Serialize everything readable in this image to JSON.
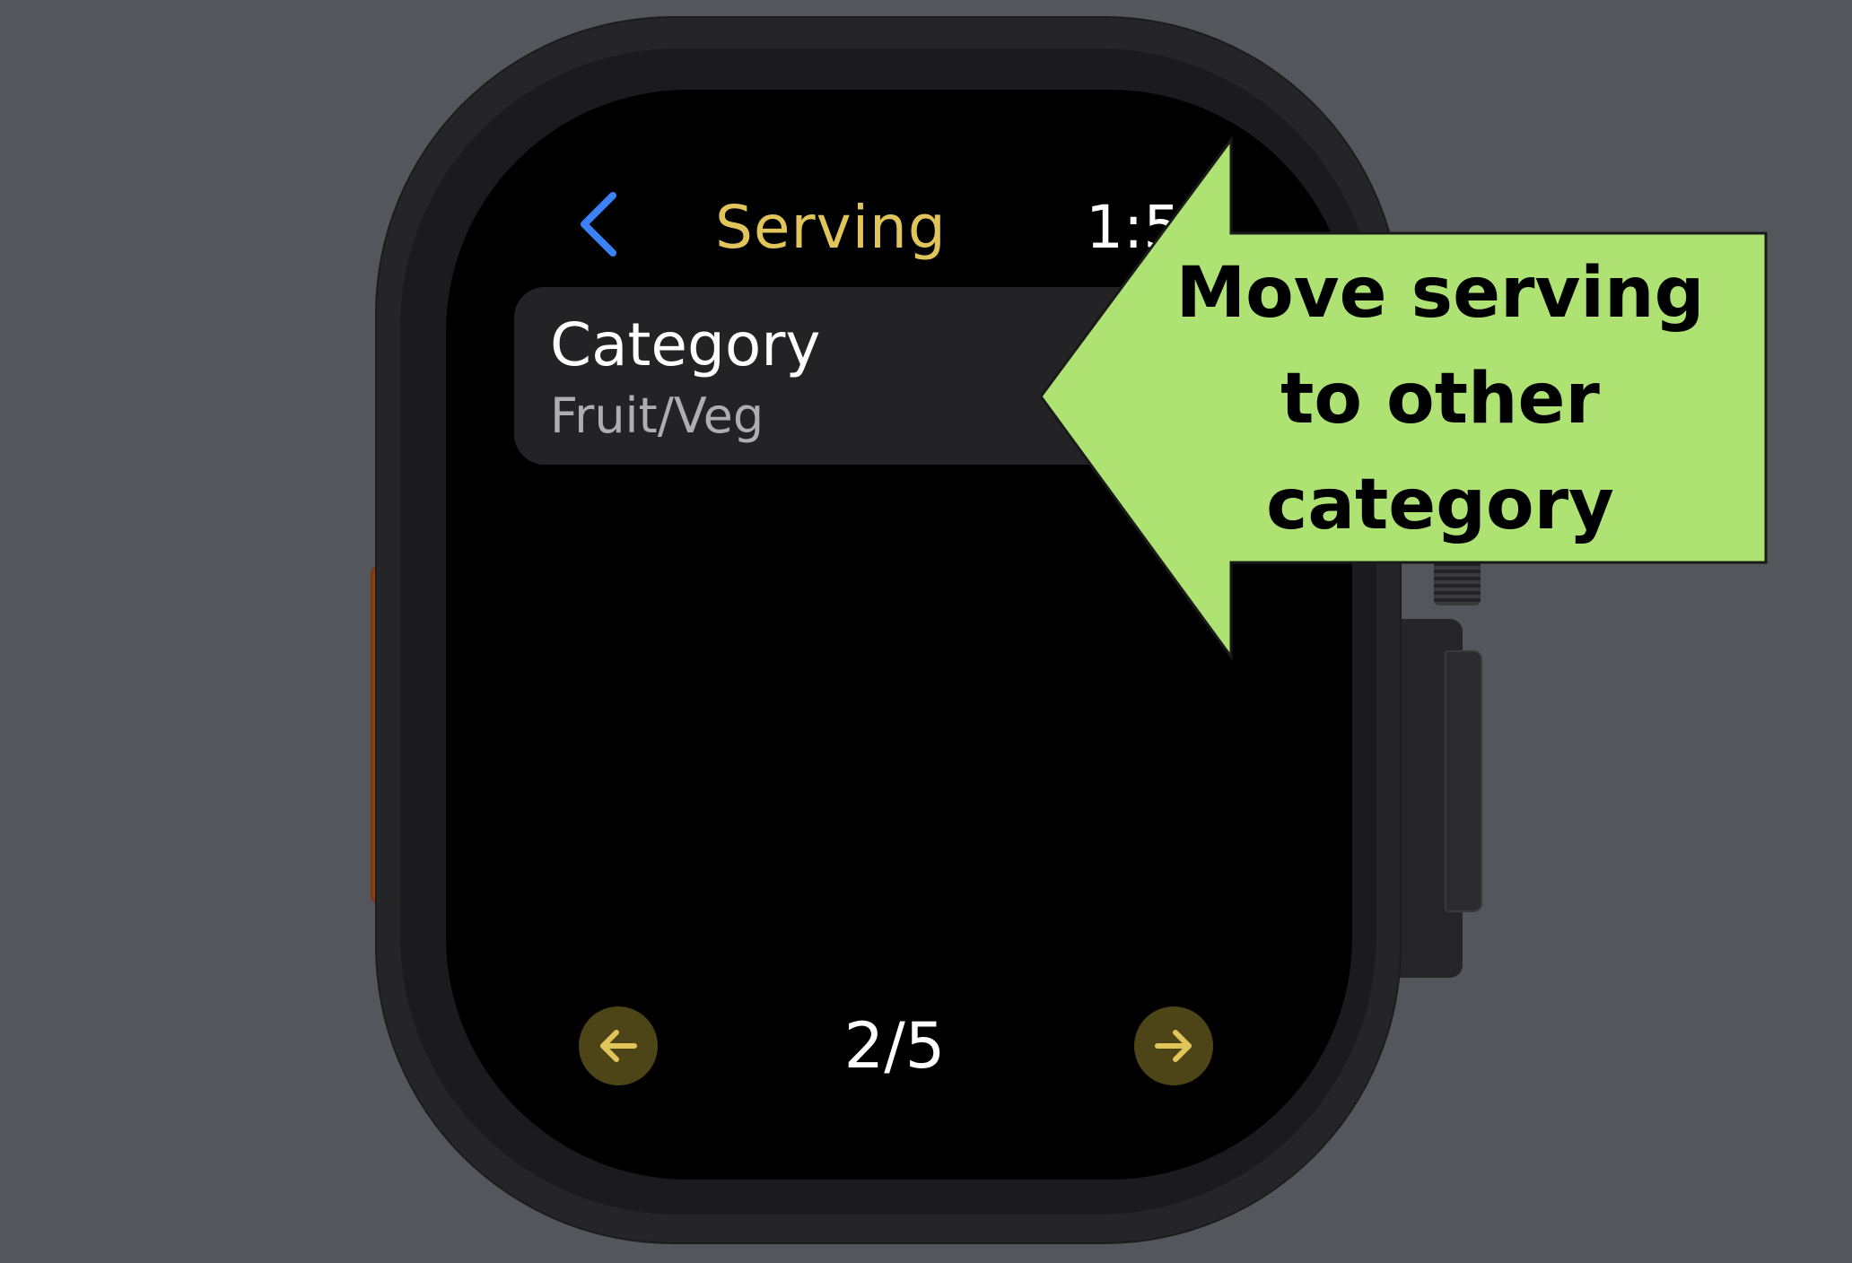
{
  "screen": {
    "back_icon": "chevron-left-icon",
    "title": "Serving",
    "clock": "1:5",
    "category_row": {
      "label": "Category",
      "value": "Fruit/Veg"
    },
    "pager": {
      "prev_icon": "arrow-left-icon",
      "counter": "2/5",
      "next_icon": "arrow-right-icon"
    }
  },
  "callout": {
    "lines": [
      "Move serving",
      "to other",
      "category"
    ],
    "arrow_icon": "arrow-left-icon"
  },
  "colors": {
    "background": "#55565b",
    "screen": "#000000",
    "title_accent": "#e2c55a",
    "back_chevron": "#3b82f6",
    "row_fill": "#232325",
    "nav_button_fill": "#4d4518",
    "nav_arrow": "#e2c55a",
    "callout_fill": "#aee374",
    "side_button": "#a84a16"
  }
}
